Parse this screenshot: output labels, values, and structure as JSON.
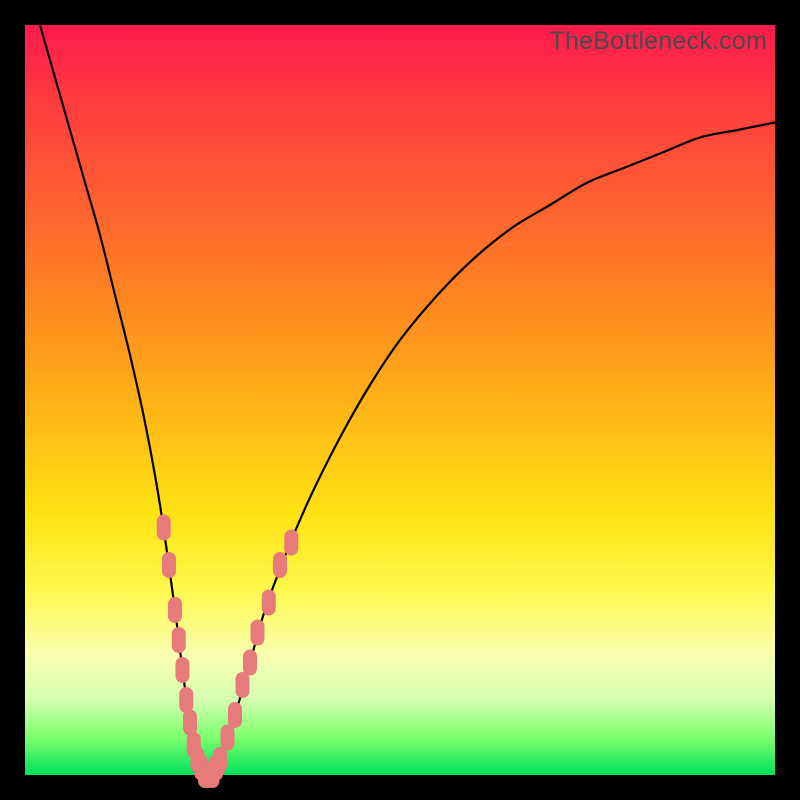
{
  "watermark": "TheBottleneck.com",
  "chart_data": {
    "type": "line",
    "title": "",
    "xlabel": "",
    "ylabel": "",
    "xlim": [
      0,
      100
    ],
    "ylim": [
      0,
      100
    ],
    "grid": false,
    "series": [
      {
        "name": "bottleneck-curve",
        "x": [
          2,
          4,
          6,
          8,
          10,
          12,
          14,
          16,
          18,
          20,
          21,
          22,
          23,
          24,
          25,
          26,
          28,
          30,
          32,
          35,
          38,
          42,
          46,
          50,
          55,
          60,
          65,
          70,
          75,
          80,
          85,
          90,
          95,
          100
        ],
        "y": [
          100,
          93,
          86,
          79,
          72,
          64,
          56,
          47,
          36,
          22,
          14,
          7,
          2,
          0,
          0,
          2,
          8,
          15,
          22,
          30,
          37,
          45,
          52,
          58,
          64,
          69,
          73,
          76,
          79,
          81,
          83,
          85,
          86,
          87
        ]
      }
    ],
    "markers": {
      "name": "highlighted-points",
      "color": "#e77a7a",
      "points": [
        {
          "x": 18.5,
          "y": 33
        },
        {
          "x": 19.2,
          "y": 28
        },
        {
          "x": 20.0,
          "y": 22
        },
        {
          "x": 20.5,
          "y": 18
        },
        {
          "x": 21.0,
          "y": 14
        },
        {
          "x": 21.5,
          "y": 10
        },
        {
          "x": 22.0,
          "y": 7
        },
        {
          "x": 22.5,
          "y": 4
        },
        {
          "x": 23.0,
          "y": 2
        },
        {
          "x": 23.5,
          "y": 1
        },
        {
          "x": 24.0,
          "y": 0
        },
        {
          "x": 24.5,
          "y": 0
        },
        {
          "x": 25.0,
          "y": 0
        },
        {
          "x": 25.5,
          "y": 1
        },
        {
          "x": 26.0,
          "y": 2
        },
        {
          "x": 27.0,
          "y": 5
        },
        {
          "x": 28.0,
          "y": 8
        },
        {
          "x": 29.0,
          "y": 12
        },
        {
          "x": 30.0,
          "y": 15
        },
        {
          "x": 31.0,
          "y": 19
        },
        {
          "x": 32.5,
          "y": 23
        },
        {
          "x": 34.0,
          "y": 28
        },
        {
          "x": 35.5,
          "y": 31
        }
      ]
    },
    "gradient_stops": [
      {
        "pos": 0,
        "color": "#ff1a4d"
      },
      {
        "pos": 10,
        "color": "#ff3b3f"
      },
      {
        "pos": 22,
        "color": "#ff5c33"
      },
      {
        "pos": 38,
        "color": "#ff8a1f"
      },
      {
        "pos": 52,
        "color": "#ffb816"
      },
      {
        "pos": 65,
        "color": "#ffe213"
      },
      {
        "pos": 75,
        "color": "#fff84a"
      },
      {
        "pos": 84,
        "color": "#faffb0"
      },
      {
        "pos": 90,
        "color": "#d4ffb0"
      },
      {
        "pos": 95,
        "color": "#7cff6e"
      },
      {
        "pos": 100,
        "color": "#00e05a"
      }
    ]
  }
}
